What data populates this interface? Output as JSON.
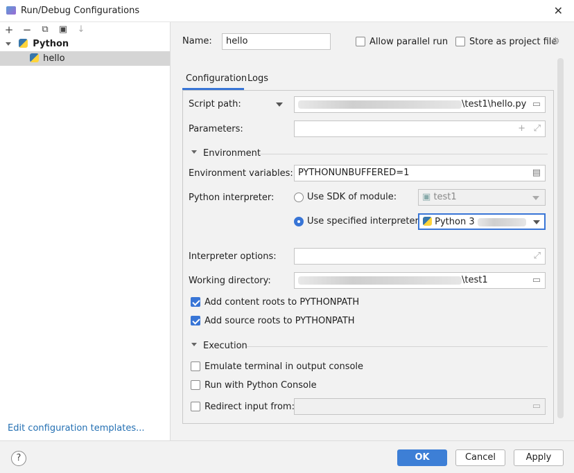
{
  "window": {
    "title": "Run/Debug Configurations"
  },
  "toolbar": {
    "add": "+",
    "remove": "−",
    "copy": "⧉",
    "folder": "▣",
    "sort": "↓"
  },
  "tree": {
    "group_label": "Python",
    "item_label": "hello"
  },
  "left_footer": {
    "edit_templates": "Edit configuration templates..."
  },
  "header": {
    "name_label": "Name:",
    "name_value": "hello",
    "allow_parallel": "Allow parallel run",
    "store_as_project": "Store as project file"
  },
  "tabs": [
    {
      "label": "Configuration"
    },
    {
      "label": "Logs"
    }
  ],
  "form": {
    "script_path_label": "Script path:",
    "script_path_suffix": "\\test1\\hello.py",
    "parameters_label": "Parameters:",
    "environment_section": "Environment",
    "env_vars_label": "Environment variables:",
    "env_vars_value": "PYTHONUNBUFFERED=1",
    "interpreter_label": "Python interpreter:",
    "use_sdk_label": "Use SDK of module:",
    "sdk_module_value": "test1",
    "use_specified_label": "Use specified interpreter:",
    "interpreter_value": "Python 3",
    "interp_options_label": "Interpreter options:",
    "working_dir_label": "Working directory:",
    "working_dir_suffix": "\\test1",
    "add_content_roots": "Add content roots to PYTHONPATH",
    "add_source_roots": "Add source roots to PYTHONPATH",
    "execution_section": "Execution",
    "emulate_terminal": "Emulate terminal in output console",
    "run_with_console": "Run with Python Console",
    "redirect_input": "Redirect input from:"
  },
  "buttons": {
    "help": "?",
    "ok": "OK",
    "cancel": "Cancel",
    "apply": "Apply"
  },
  "colors": {
    "accent": "#3875d6",
    "link": "#2470b3",
    "selection": "#d5d5d5"
  }
}
